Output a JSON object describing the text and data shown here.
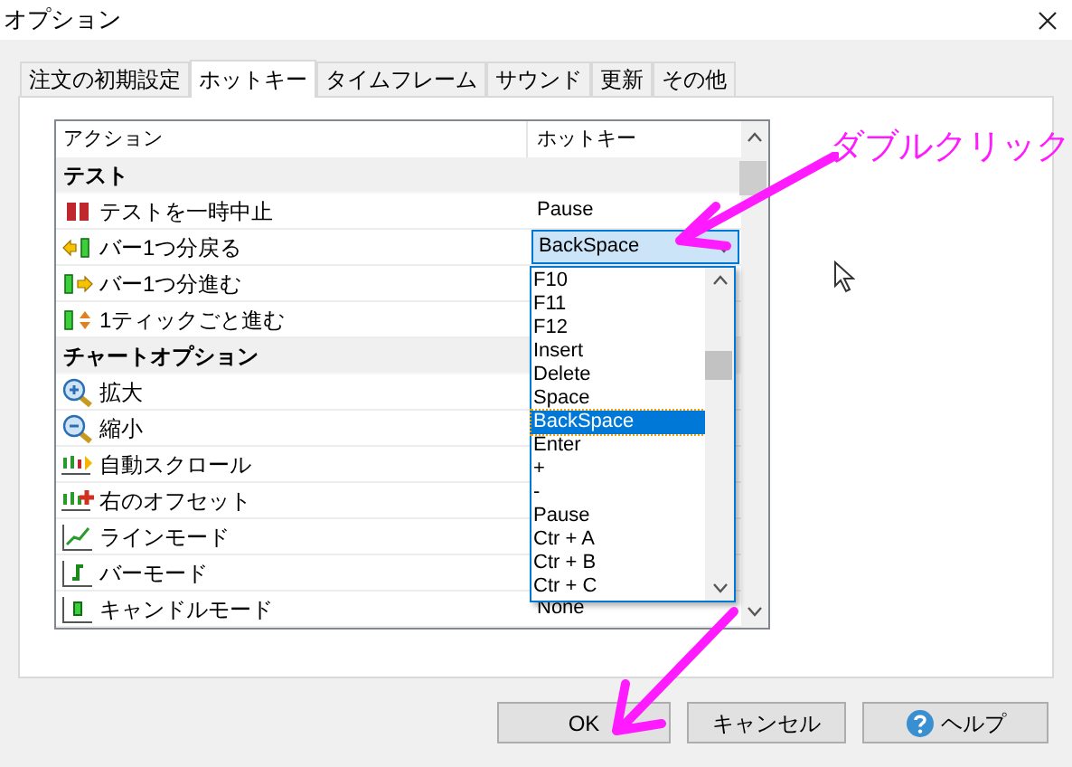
{
  "window": {
    "title": "オプション"
  },
  "tabs": [
    {
      "label": "注文の初期設定",
      "selected": false
    },
    {
      "label": "ホットキー",
      "selected": true
    },
    {
      "label": "タイムフレーム",
      "selected": false
    },
    {
      "label": "サウンド",
      "selected": false
    },
    {
      "label": "更新",
      "selected": false
    },
    {
      "label": "その他",
      "selected": false
    }
  ],
  "table": {
    "columns": [
      "アクション",
      "ホットキー"
    ],
    "rows": [
      {
        "kind": "group",
        "action": "テスト"
      },
      {
        "kind": "item",
        "action": "テストを一時中止",
        "hotkey": "Pause"
      },
      {
        "kind": "item",
        "action": "バー1つ分戻る",
        "hotkey": "BackSpace",
        "expanded": true
      },
      {
        "kind": "item",
        "action": "バー1つ分進む"
      },
      {
        "kind": "item",
        "action": "1ティックごと進む"
      },
      {
        "kind": "group",
        "action": "チャートオプション"
      },
      {
        "kind": "item",
        "action": "拡大"
      },
      {
        "kind": "item",
        "action": "縮小"
      },
      {
        "kind": "item",
        "action": "自動スクロール"
      },
      {
        "kind": "item",
        "action": "右のオフセット"
      },
      {
        "kind": "item",
        "action": "ラインモード"
      },
      {
        "kind": "item",
        "action": "バーモード"
      },
      {
        "kind": "item",
        "action": "キャンドルモード",
        "hotkey": "None"
      }
    ]
  },
  "dropdown_options": [
    {
      "label": "F10",
      "selected": false
    },
    {
      "label": "F11",
      "selected": false
    },
    {
      "label": "F12",
      "selected": false
    },
    {
      "label": "Insert",
      "selected": false
    },
    {
      "label": "Delete",
      "selected": false
    },
    {
      "label": "Space",
      "selected": false
    },
    {
      "label": "BackSpace",
      "selected": true
    },
    {
      "label": "Enter",
      "selected": false
    },
    {
      "label": "+",
      "selected": false
    },
    {
      "label": "-",
      "selected": false
    },
    {
      "label": "Pause",
      "selected": false
    },
    {
      "label": "Ctr + A",
      "selected": false
    },
    {
      "label": "Ctr + B",
      "selected": false
    },
    {
      "label": "Ctr + C",
      "selected": false
    }
  ],
  "annotation": "ダブルクリック",
  "buttons": [
    {
      "label": "OK",
      "kind": "plain"
    },
    {
      "label": "キャンセル",
      "kind": "plain"
    },
    {
      "label": "ヘルプ",
      "kind": "help"
    }
  ]
}
